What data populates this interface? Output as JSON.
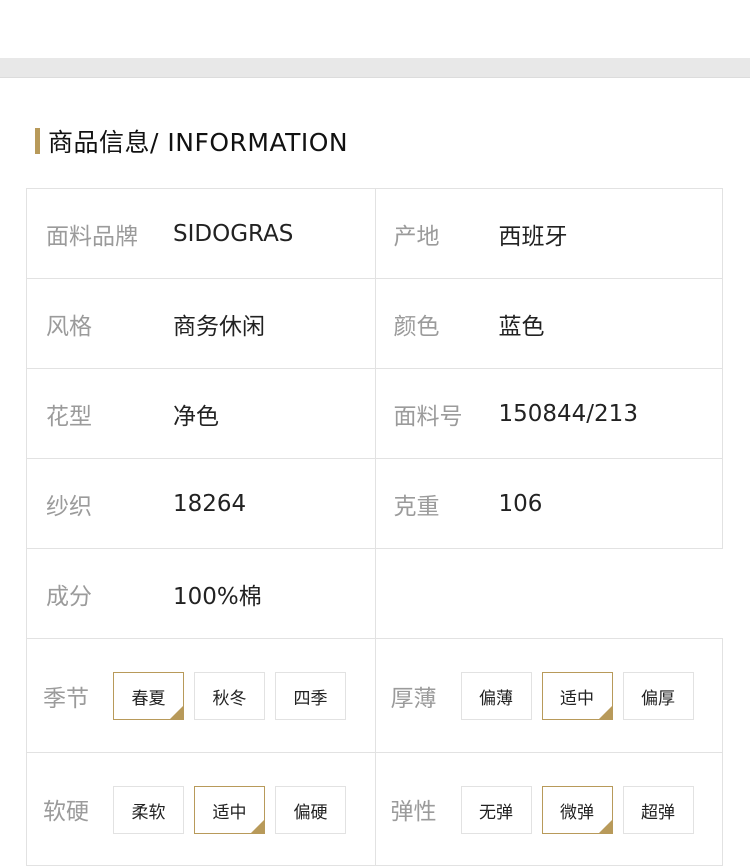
{
  "section": {
    "title": "商品信息/ INFORMATION"
  },
  "attributes": [
    {
      "label": "面料品牌",
      "value": "SIDOGRAS"
    },
    {
      "label": "产地",
      "value": "西班牙"
    },
    {
      "label": "风格",
      "value": "商务休闲"
    },
    {
      "label": "颜色",
      "value": "蓝色"
    },
    {
      "label": "花型",
      "value": "净色"
    },
    {
      "label": "面料号",
      "value": "150844/213"
    },
    {
      "label": "纱织",
      "value": "18264"
    },
    {
      "label": "克重",
      "value": "106"
    },
    {
      "label": "成分",
      "value": "100%棉"
    }
  ],
  "option_groups": [
    {
      "label": "季节",
      "options": [
        "春夏",
        "秋冬",
        "四季"
      ],
      "selected": "春夏"
    },
    {
      "label": "厚薄",
      "options": [
        "偏薄",
        "适中",
        "偏厚"
      ],
      "selected": "适中"
    },
    {
      "label": "软硬",
      "options": [
        "柔软",
        "适中",
        "偏硬"
      ],
      "selected": "适中"
    },
    {
      "label": "弹性",
      "options": [
        "无弹",
        "微弹",
        "超弹"
      ],
      "selected": "微弹"
    }
  ],
  "colors": {
    "accent": "#b89a5a",
    "label": "#9b9b9b",
    "border": "#e2e2e2",
    "band": "#e8e8e8"
  }
}
